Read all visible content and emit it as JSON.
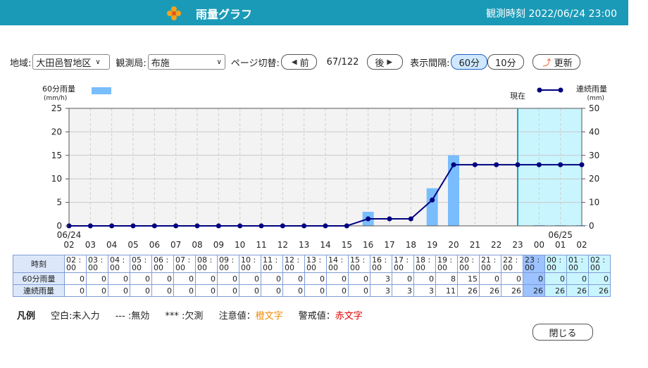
{
  "header": {
    "title": "雨量グラフ",
    "observation_time": "観測時刻 2022/06/24 23:00",
    "bg_color": "#1a9ab7"
  },
  "toolbar": {
    "region_label": "地域:",
    "region_value": "大田邑智地区",
    "station_label": "観測局:",
    "station_value": "布施",
    "page_label": "ページ切替:",
    "prev_button": "前",
    "page_indicator": "67/122",
    "next_button": "後",
    "interval_label": "表示間隔:",
    "interval_60": "60分",
    "interval_10": "10分",
    "refresh_button": "更新"
  },
  "chart_data": {
    "type": "bar+line",
    "left_axis_label": "60分雨量",
    "left_axis_unit": "(mm/h)",
    "right_axis_label": "連続雨量",
    "right_axis_unit": "(mm)",
    "now_label": "現在",
    "left_ylim": [
      0,
      25
    ],
    "left_ticks": [
      0,
      5,
      10,
      15,
      20,
      25
    ],
    "right_ylim": [
      0,
      50
    ],
    "right_ticks": [
      0,
      10,
      20,
      30,
      40,
      50
    ],
    "x_ticks": [
      "02",
      "03",
      "04",
      "05",
      "06",
      "07",
      "08",
      "09",
      "10",
      "11",
      "12",
      "13",
      "14",
      "15",
      "16",
      "17",
      "18",
      "19",
      "20",
      "21",
      "22",
      "23",
      "00",
      "01",
      "02"
    ],
    "date_labels": [
      {
        "label": "06/24",
        "index": 0
      },
      {
        "label": "06/25",
        "index": 22
      }
    ],
    "bar_values": [
      0,
      0,
      0,
      0,
      0,
      0,
      0,
      0,
      0,
      0,
      0,
      0,
      0,
      0,
      3,
      0,
      0,
      8,
      15,
      0,
      0,
      0,
      0,
      0,
      0
    ],
    "line_values": [
      0,
      0,
      0,
      0,
      0,
      0,
      0,
      0,
      0,
      0,
      0,
      0,
      0,
      0,
      3,
      3,
      3,
      11,
      26,
      26,
      26,
      26,
      26,
      26,
      26
    ],
    "now_index": 21,
    "bar_color": "#79bdfd",
    "line_color": "#000080",
    "future_bg": "#c9f5ff",
    "now_line_color": "#17a2c8"
  },
  "table": {
    "row_time_label": "時刻",
    "row_rain_label": "60分雨量",
    "row_cum_label": "連続雨量",
    "times": [
      "02：00",
      "03：00",
      "04：00",
      "05：00",
      "06：00",
      "07：00",
      "08：00",
      "09：00",
      "10：00",
      "11：00",
      "12：00",
      "13：00",
      "14：00",
      "15：00",
      "16：00",
      "17：00",
      "18：00",
      "19：00",
      "20：00",
      "21：00",
      "22：00",
      "23：00",
      "00：00",
      "01：00",
      "02：00"
    ],
    "rain": [
      "0",
      "0",
      "0",
      "0",
      "0",
      "0",
      "0",
      "0",
      "0",
      "0",
      "0",
      "0",
      "0",
      "0",
      "3",
      "0",
      "0",
      "8",
      "15",
      "0",
      "0",
      "0",
      "0",
      "0",
      "0"
    ],
    "cumulative": [
      "0",
      "0",
      "0",
      "0",
      "0",
      "0",
      "0",
      "0",
      "0",
      "0",
      "0",
      "0",
      "0",
      "0",
      "3",
      "3",
      "3",
      "11",
      "26",
      "26",
      "26",
      "26",
      "26",
      "26",
      "26"
    ]
  },
  "legend": {
    "heading": "凡例",
    "blank": "空白:未入力",
    "invalid": "--- :無効",
    "missing": "*** :欠測",
    "caution_prefix": "注意値：",
    "caution_text": "橙文字",
    "warning_prefix": "警戒値：",
    "warning_text": "赤文字"
  },
  "footer": {
    "close_button": "閉じる"
  }
}
